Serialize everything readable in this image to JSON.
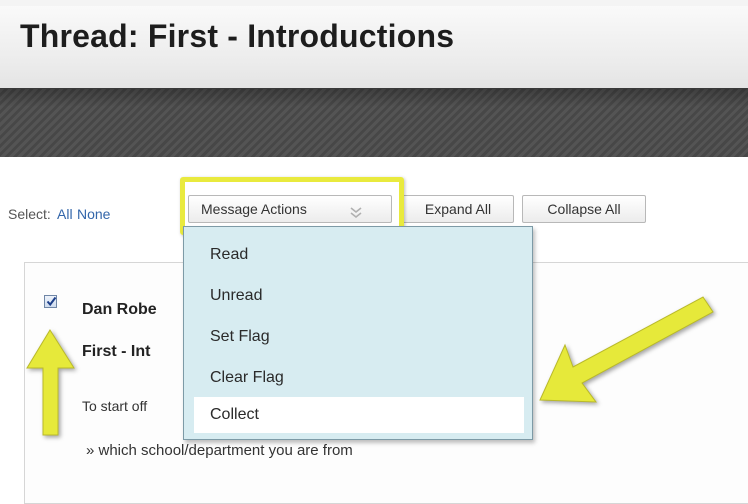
{
  "page": {
    "title": "Thread: First - Introductions"
  },
  "toolbar": {
    "select_label": "Select:",
    "select_all": "All",
    "select_none": "None",
    "message_actions_label": "Message Actions",
    "expand_all_label": "Expand All",
    "collapse_all_label": "Collapse All"
  },
  "message_actions_menu": {
    "items": [
      "Read",
      "Unread",
      "Set Flag",
      "Clear Flag",
      "Collect"
    ],
    "highlighted": "Collect"
  },
  "message": {
    "checked": true,
    "author": "Dan Robe",
    "subject": "First - Int",
    "body_start": "To start off",
    "bullet": "» which school/department you are from"
  },
  "colors": {
    "highlight": "#e9ea3e",
    "menu_background": "#d7ecf1",
    "link": "#3366aa",
    "header_band": "#4b4b4b"
  },
  "icons": {
    "dropdown": "double-chevron-down-icon",
    "checkbox": "checkmark-icon",
    "annotation": "yellow-arrow-icon"
  }
}
